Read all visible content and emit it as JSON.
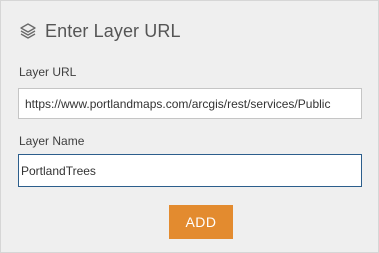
{
  "header": {
    "icon": "layers-icon",
    "title": "Enter Layer URL"
  },
  "form": {
    "url_label": "Layer URL",
    "url_value": "https://www.portlandmaps.com/arcgis/rest/services/Public",
    "name_label": "Layer Name",
    "name_value": "PortlandTrees"
  },
  "actions": {
    "add_label": "ADD"
  },
  "colors": {
    "accent": "#e38b2f",
    "focus_border": "#2c5e8c",
    "panel_bg": "#efefef"
  }
}
